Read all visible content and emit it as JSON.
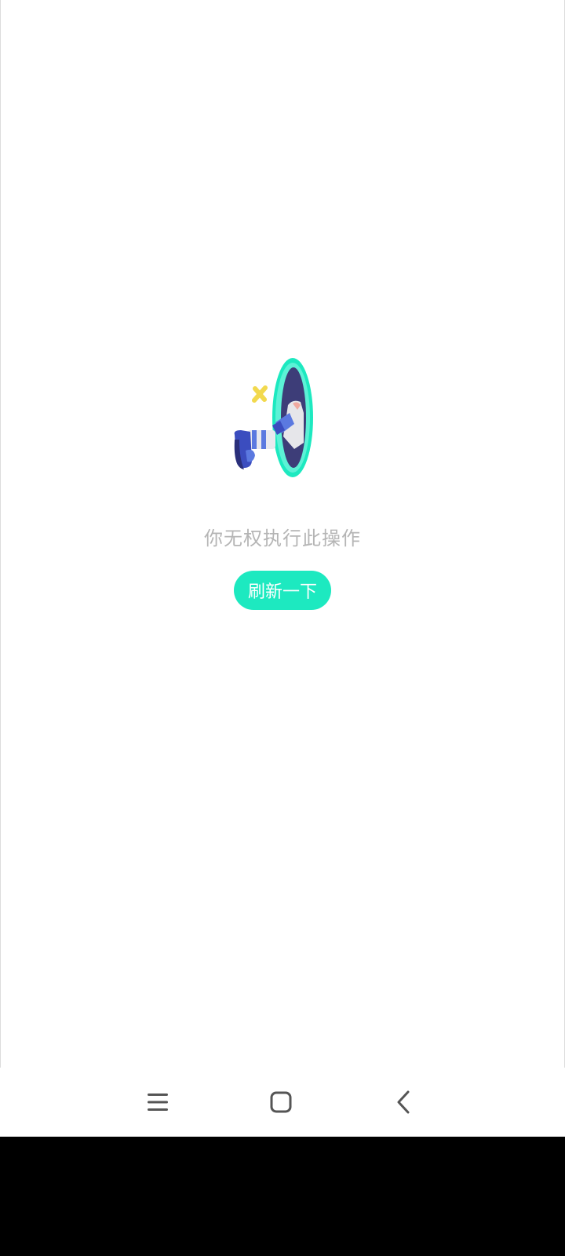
{
  "message": "你无权执行此操作",
  "refresh_button": {
    "label": "刷新一下"
  },
  "colors": {
    "accent": "#1de9c0",
    "message_text": "#b5b5b5",
    "portal_inner": "#3d3d78",
    "sparkle": "#f2d94e",
    "shoe": "#3b4dbf"
  },
  "navbar": {
    "menu_icon": "menu-icon",
    "home_icon": "home-icon",
    "back_icon": "back-icon"
  }
}
